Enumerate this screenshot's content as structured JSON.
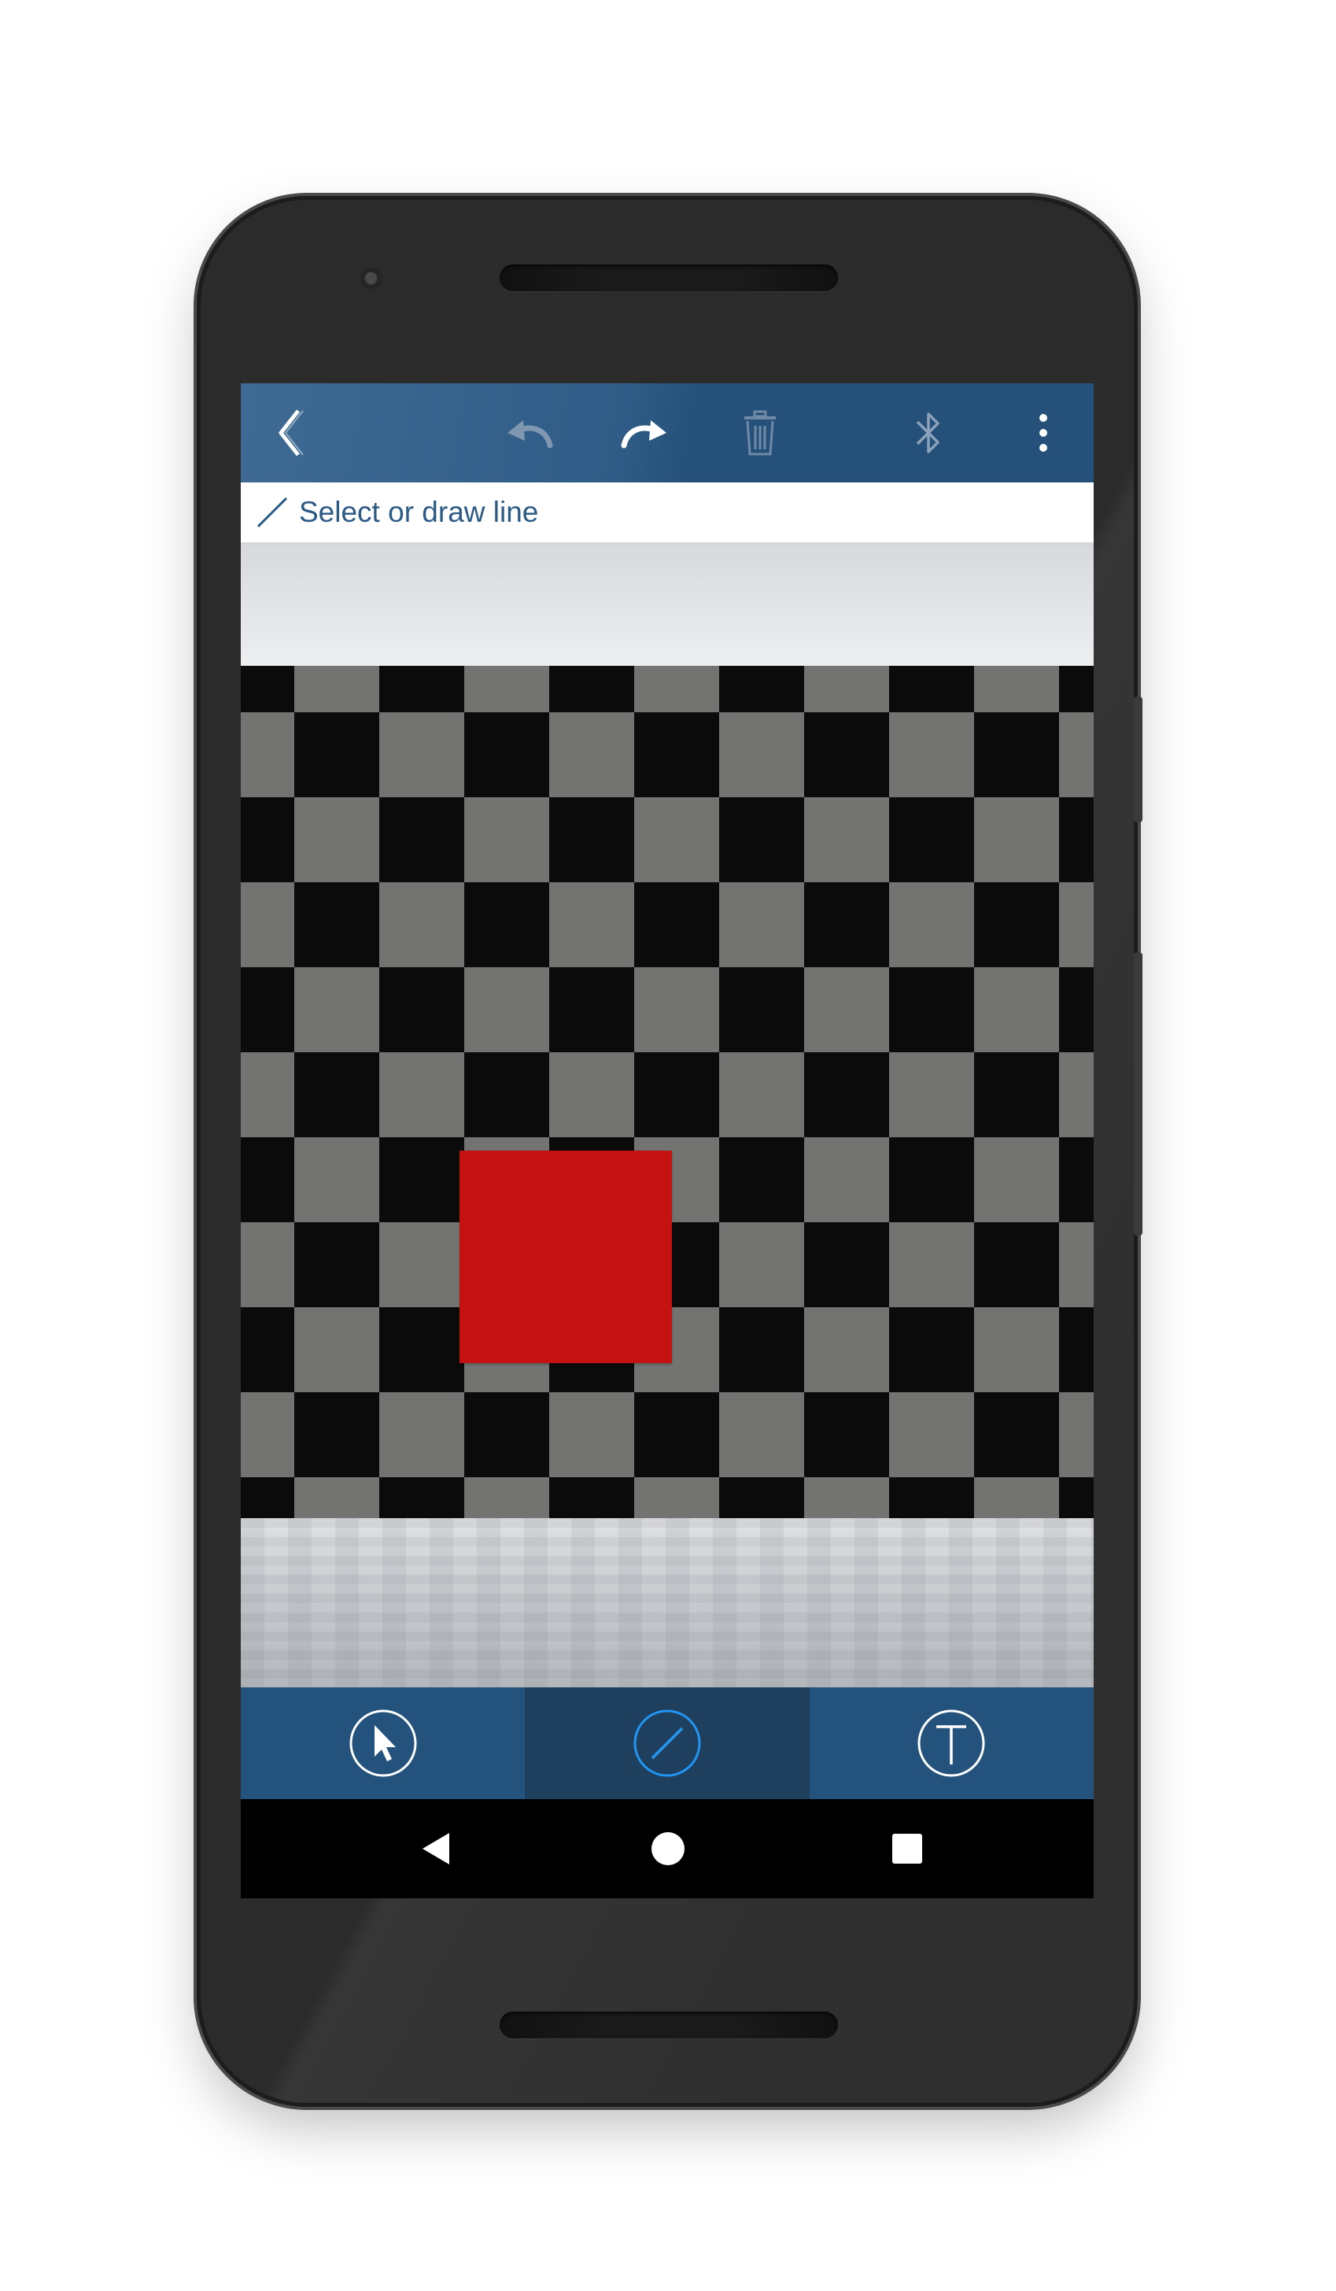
{
  "device": {
    "body_color": "#2b2b2b",
    "frame_icons": [
      "front-camera",
      "earpiece-speaker",
      "bottom-speaker"
    ]
  },
  "toolbar": {
    "background": "#24507a",
    "buttons": [
      {
        "name": "back-button",
        "icon": "chevron-left-icon",
        "enabled": true
      },
      {
        "name": "undo-button",
        "icon": "undo-icon",
        "enabled": false
      },
      {
        "name": "redo-button",
        "icon": "redo-icon",
        "enabled": true
      },
      {
        "name": "delete-button",
        "icon": "trash-icon",
        "enabled": false
      },
      {
        "name": "bluetooth-button",
        "icon": "bluetooth-icon",
        "enabled": false
      },
      {
        "name": "more-button",
        "icon": "overflow-menu-icon",
        "enabled": true
      }
    ]
  },
  "hint": {
    "icon": "line-icon",
    "text": "Select or draw line",
    "color": "#2c5a86"
  },
  "canvas": {
    "pattern": "checkerboard",
    "colors": {
      "dark": "#0b0b0b",
      "light": "#737472",
      "shape": "#c41212"
    },
    "shape": "red-square"
  },
  "bottom_toolbar": {
    "tabs": [
      {
        "name": "select-tool",
        "icon": "pointer-icon",
        "active": false
      },
      {
        "name": "line-tool",
        "icon": "line-icon",
        "active": true
      },
      {
        "name": "text-tool",
        "icon": "text-icon",
        "active": false
      }
    ],
    "active_color": "#2196f3"
  },
  "navbar": {
    "buttons": [
      "back-triangle-icon",
      "home-circle-icon",
      "recents-square-icon"
    ]
  }
}
